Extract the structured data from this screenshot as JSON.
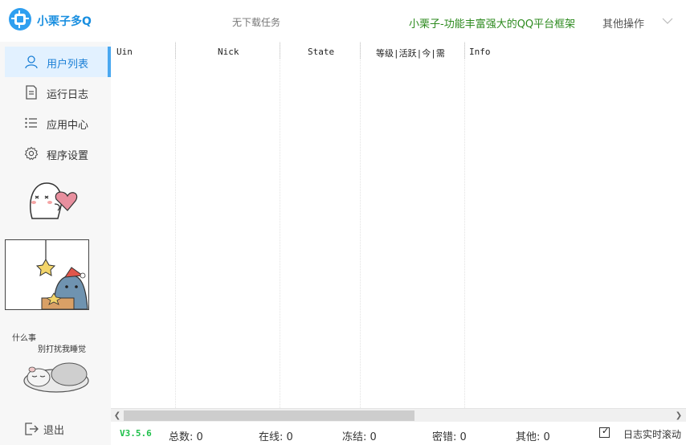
{
  "header": {
    "app_title": "小栗子多Q",
    "task_status": "无下载任务",
    "slogan": "小栗子-功能丰富强大的QQ平台框架",
    "more_ops": "其他操作",
    "colors": {
      "brand": "#1a8fe0",
      "slogan": "#2c8a1e"
    }
  },
  "sidebar": {
    "items": [
      {
        "label": "用户列表",
        "icon": "user-icon",
        "active": true
      },
      {
        "label": "运行日志",
        "icon": "document-icon",
        "active": false
      },
      {
        "label": "应用中心",
        "icon": "list-icon",
        "active": false
      },
      {
        "label": "程序设置",
        "icon": "gear-icon",
        "active": false
      }
    ],
    "sticker_caption": [
      "什么事",
      "别打扰我睡觉"
    ],
    "logout": "退出"
  },
  "table": {
    "columns": [
      "Uin",
      "Nick",
      "State",
      "等级|活跃|今|需",
      "Info"
    ],
    "rows": []
  },
  "statusbar": {
    "version": "V3.5.6",
    "stats": [
      {
        "label": "总数:",
        "value": "0"
      },
      {
        "label": "在线:",
        "value": "0"
      },
      {
        "label": "冻结:",
        "value": "0"
      },
      {
        "label": "密错:",
        "value": "0"
      },
      {
        "label": "其他:",
        "value": "0"
      }
    ],
    "log_scroll_label": "日志实时滚动",
    "log_scroll_checked": true
  }
}
